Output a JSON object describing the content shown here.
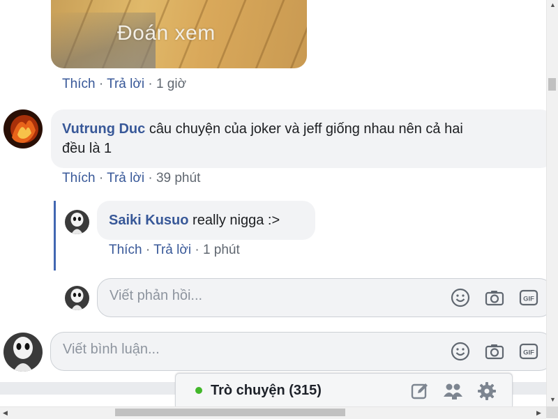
{
  "photo_comment": {
    "image_caption": "Đoán xem",
    "actions": {
      "like": "Thích",
      "reply": "Trả lời",
      "time": "1 giờ",
      "sep": "·"
    }
  },
  "comment": {
    "author": "Vutrung Duc",
    "text": "câu chuyện của joker và jeff giống nhau nên cả hai",
    "text_line2": "đều là 1",
    "actions": {
      "like": "Thích",
      "reply": "Trả lời",
      "time": "39 phút",
      "sep": "·"
    }
  },
  "reply": {
    "author": "Saiki Kusuo",
    "text": "really nigga :>",
    "actions": {
      "like": "Thích",
      "reply": "Trả lời",
      "time": "1 phút",
      "sep": "·"
    }
  },
  "reply_input": {
    "placeholder": "Viết phản hồi..."
  },
  "comment_input": {
    "placeholder": "Viết bình luận..."
  },
  "input_icons": [
    "smiley-icon",
    "camera-icon",
    "gif-icon"
  ],
  "chat": {
    "label": "Trò chuyện (315)",
    "status_color": "#42b72a",
    "icons": [
      "compose-icon",
      "group-icon",
      "gear-icon"
    ]
  },
  "colors": {
    "link": "#385898",
    "bubble": "#f2f3f5",
    "reply_line": "#4267b2"
  }
}
